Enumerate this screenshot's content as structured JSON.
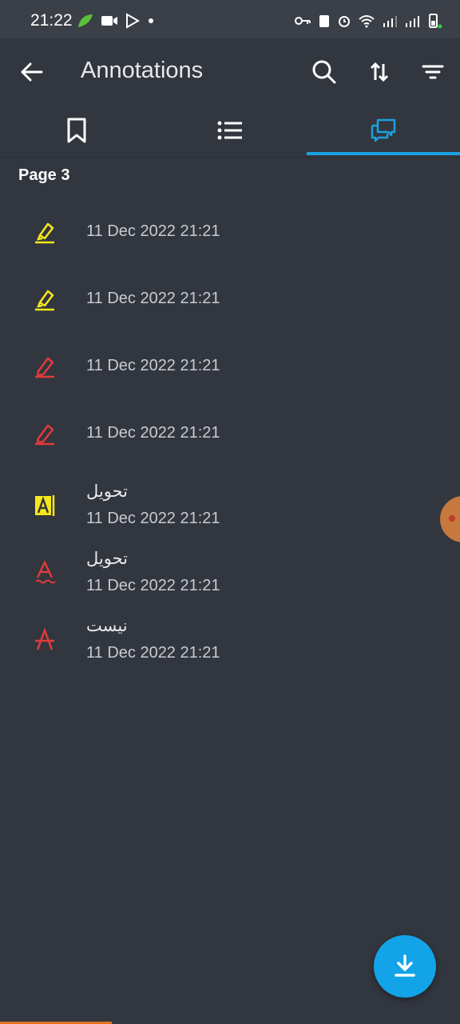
{
  "status_bar": {
    "time": "21:22"
  },
  "app_bar": {
    "title": "Annotations"
  },
  "tabs": [
    {
      "icon": "bookmark-icon"
    },
    {
      "icon": "list-icon"
    },
    {
      "icon": "comments-icon",
      "selected": true
    }
  ],
  "section": {
    "header": "Page 3"
  },
  "annotations": [
    {
      "icon": "highlighter-icon",
      "color": "#f5e71c",
      "text": "",
      "date": "11 Dec 2022 21:21"
    },
    {
      "icon": "highlighter-icon",
      "color": "#f5e71c",
      "text": "",
      "date": "11 Dec 2022 21:21"
    },
    {
      "icon": "pen-icon",
      "color": "#e03b3b",
      "text": "",
      "date": "11 Dec 2022 21:21"
    },
    {
      "icon": "pen-icon",
      "color": "#e03b3b",
      "text": "",
      "date": "11 Dec 2022 21:21"
    },
    {
      "icon": "text-highlight-icon",
      "color": "#f5e71c",
      "text": "تحويل",
      "date": "11 Dec 2022 21:21"
    },
    {
      "icon": "text-squiggly-icon",
      "color": "#e03b3b",
      "text": "تحويل",
      "date": "11 Dec 2022 21:21"
    },
    {
      "icon": "text-strikeout-icon",
      "color": "#e03b3b",
      "text": "نيست",
      "date": "11 Dec 2022 21:21"
    }
  ],
  "colors": {
    "accent": "#1aa1e0",
    "background": "#32363e",
    "fab": "#12a3e8"
  }
}
